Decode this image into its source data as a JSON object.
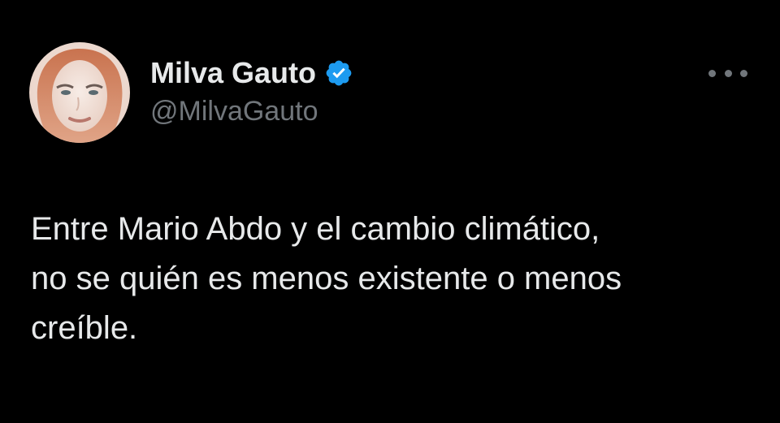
{
  "author": {
    "display_name": "Milva Gauto",
    "handle": "@MilvaGauto",
    "verified": true,
    "avatar_icon": "profile-photo"
  },
  "menu": {
    "icon": "more-horizontal-icon"
  },
  "tweet": {
    "lines": [
      "Entre Mario Abdo y el cambio climático,",
      "no se quién es menos existente o menos",
      "creíble."
    ]
  },
  "colors": {
    "background": "#000000",
    "text_primary": "#e7e9ea",
    "text_secondary": "#71767b",
    "verified_badge": "#1d9bf0"
  }
}
